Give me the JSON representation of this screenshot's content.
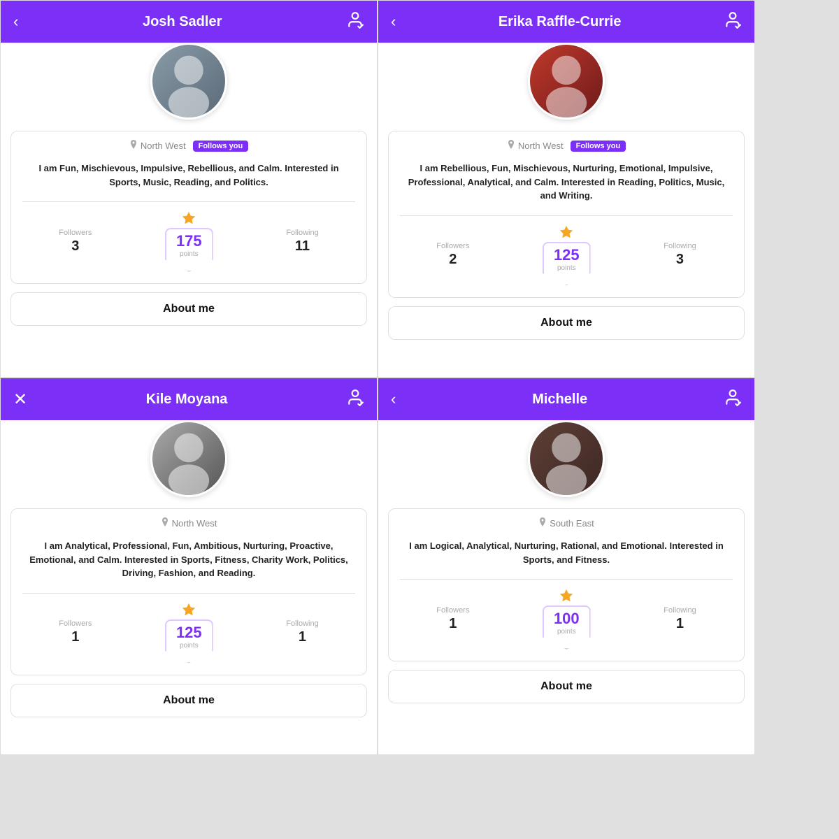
{
  "panels": [
    {
      "id": "josh",
      "header": {
        "title": "Josh Sadler",
        "back_icon": "‹",
        "profile_icon": "👤",
        "back_type": "back"
      },
      "location": "North West",
      "follows_you": true,
      "bio": "I am Fun, Mischievous, Impulsive, Rebellious, and Calm. Interested in Sports, Music, Reading, and Politics.",
      "followers": 3,
      "points": 175,
      "following": 11,
      "about_me_title": "About me",
      "avatar_class": "avatar-josh"
    },
    {
      "id": "erika",
      "header": {
        "title": "Erika Raffle-Currie",
        "back_icon": "‹",
        "profile_icon": "👤",
        "back_type": "back"
      },
      "location": "North West",
      "follows_you": true,
      "bio": "I am Rebellious, Fun, Mischievous, Nurturing, Emotional, Impulsive, Professional, Analytical, and Calm. Interested in Reading, Politics, Music, and Writing.",
      "followers": 2,
      "points": 125,
      "following": 3,
      "about_me_title": "About me",
      "avatar_class": "avatar-erika"
    },
    {
      "id": "kile",
      "header": {
        "title": "Kile Moyana",
        "back_icon": "✕",
        "profile_icon": "👤",
        "back_type": "close"
      },
      "location": "North West",
      "follows_you": false,
      "bio": "I am Analytical, Professional, Fun, Ambitious, Nurturing, Proactive, Emotional, and Calm. Interested in Sports, Fitness, Charity Work, Politics, Driving, Fashion, and Reading.",
      "followers": 1,
      "points": 125,
      "following": 1,
      "about_me_title": "About me",
      "avatar_class": "avatar-kile"
    },
    {
      "id": "michelle",
      "header": {
        "title": "Michelle",
        "back_icon": "‹",
        "profile_icon": "👤",
        "back_type": "back"
      },
      "location": "South East",
      "follows_you": false,
      "bio": "I am Logical, Analytical, Nurturing, Rational, and Emotional. Interested in Sports, and Fitness.",
      "followers": 1,
      "points": 100,
      "following": 1,
      "about_me_title": "About me",
      "avatar_class": "avatar-michelle"
    }
  ],
  "labels": {
    "followers": "Followers",
    "following": "Following",
    "points": "points",
    "follows_you": "Follows you"
  }
}
